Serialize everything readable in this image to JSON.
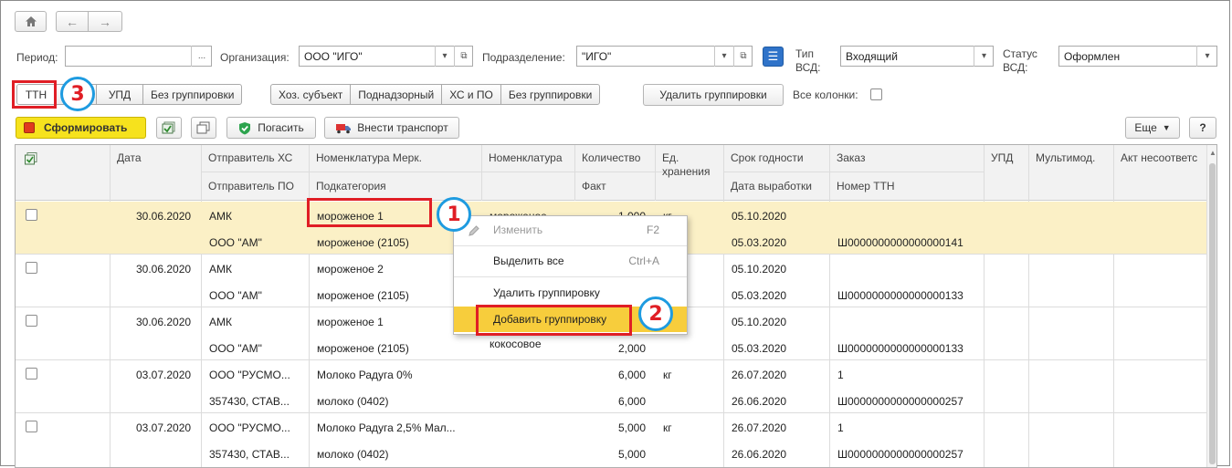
{
  "toolbar": {
    "period_label": "Период:",
    "period_value": "",
    "period_btn": "...",
    "org_label": "Организация:",
    "org_value": "ООО \"ИГО\"",
    "dept_label": "Подразделение:",
    "dept_value": "\"ИГО\"",
    "vsd_type_label_1": "Тип",
    "vsd_type_label_2": "ВСД:",
    "vsd_type_value": "Входящий",
    "vsd_status_label_1": "Статус",
    "vsd_status_label_2": "ВСД:",
    "vsd_status_value": "Оформлен"
  },
  "grouping": {
    "group1": [
      "ТТН",
      "УПД",
      "Без группировки"
    ],
    "group2": [
      "Хоз. субъект",
      "Поднадзорный",
      "ХС и ПО",
      "Без группировки"
    ],
    "delete_grouping": "Удалить группировки",
    "all_columns_label": "Все колонки:"
  },
  "actions": {
    "form": "Сформировать",
    "repay": "Погасить",
    "add_transport": "Внести транспорт",
    "more": "Еще",
    "help": "?"
  },
  "table": {
    "header_top": [
      "Дата",
      "Отправитель ХС",
      "Номенклатура Мерк.",
      "Номенклатура",
      "Количество",
      "Ед.",
      "Срок годности",
      "Заказ",
      "УПД",
      "Мультимод.",
      "Акт несоответс"
    ],
    "header_bottom": [
      "Отправитель ПО",
      "Подкатегория",
      "Факт",
      "хранения",
      "Дата выработки",
      "Номер ТТН"
    ],
    "rows": [
      {
        "date": "30.06.2020",
        "sender": "АМК",
        "sender_po": "ООО \"АМ\"",
        "nom_merc": "мороженое 1",
        "subcat": "мороженое (2105)",
        "nom": "мороженое",
        "nom2": "",
        "qty": "1,000",
        "fact": "",
        "unit": "кг",
        "exp": "05.10.2020",
        "prod": "05.03.2020",
        "order": "",
        "ttn": "Ш0000000000000000141"
      },
      {
        "date": "30.06.2020",
        "sender": "АМК",
        "sender_po": "ООО \"АМ\"",
        "nom_merc": "мороженое 2",
        "subcat": "мороженое (2105)",
        "nom": "",
        "nom2": "",
        "qty": "",
        "fact": "",
        "unit": "",
        "exp": "05.10.2020",
        "prod": "05.03.2020",
        "order": "",
        "ttn": "Ш0000000000000000133"
      },
      {
        "date": "30.06.2020",
        "sender": "АМК",
        "sender_po": "ООО \"АМ\"",
        "nom_merc": "мороженое 1",
        "subcat": "мороженое (2105)",
        "nom": "",
        "nom2": "кокосовое",
        "qty": "",
        "fact": "2,000",
        "unit": "",
        "exp": "05.10.2020",
        "prod": "05.03.2020",
        "order": "",
        "ttn": "Ш0000000000000000133"
      },
      {
        "date": "03.07.2020",
        "sender": "ООО \"РУСМО...",
        "sender_po": "357430, СТАВ...",
        "nom_merc": "Молоко Радуга 0%",
        "subcat": "молоко (0402)",
        "nom": "",
        "nom2": "",
        "qty": "6,000",
        "fact": "6,000",
        "unit": "кг",
        "exp": "26.07.2020",
        "prod": "26.06.2020",
        "order": "1",
        "ttn": "Ш0000000000000000257"
      },
      {
        "date": "03.07.2020",
        "sender": "ООО \"РУСМО...",
        "sender_po": "357430, СТАВ...",
        "nom_merc": "Молоко Радуга 2,5% Мал...",
        "subcat": "молоко (0402)",
        "nom": "",
        "nom2": "",
        "qty": "5,000",
        "fact": "5,000",
        "unit": "кг",
        "exp": "26.07.2020",
        "prod": "26.06.2020",
        "order": "1",
        "ttn": "Ш0000000000000000257"
      }
    ]
  },
  "context_menu": {
    "items": [
      {
        "label": "Изменить",
        "shortcut": "F2"
      },
      {
        "label": "Выделить все",
        "shortcut": "Ctrl+A"
      },
      {
        "label": "Удалить группировку",
        "shortcut": ""
      },
      {
        "label": "Добавить группировку",
        "shortcut": ""
      }
    ]
  },
  "callouts": [
    "1",
    "2",
    "3"
  ],
  "colors": {
    "selected_row": "#fbf0c6",
    "menu_highlight": "#f7cd3c",
    "annotation_red": "#e01e25",
    "annotation_blue": "#1e9be0",
    "form_button": "#f6e21d",
    "green_text": "#1e7b2f"
  }
}
